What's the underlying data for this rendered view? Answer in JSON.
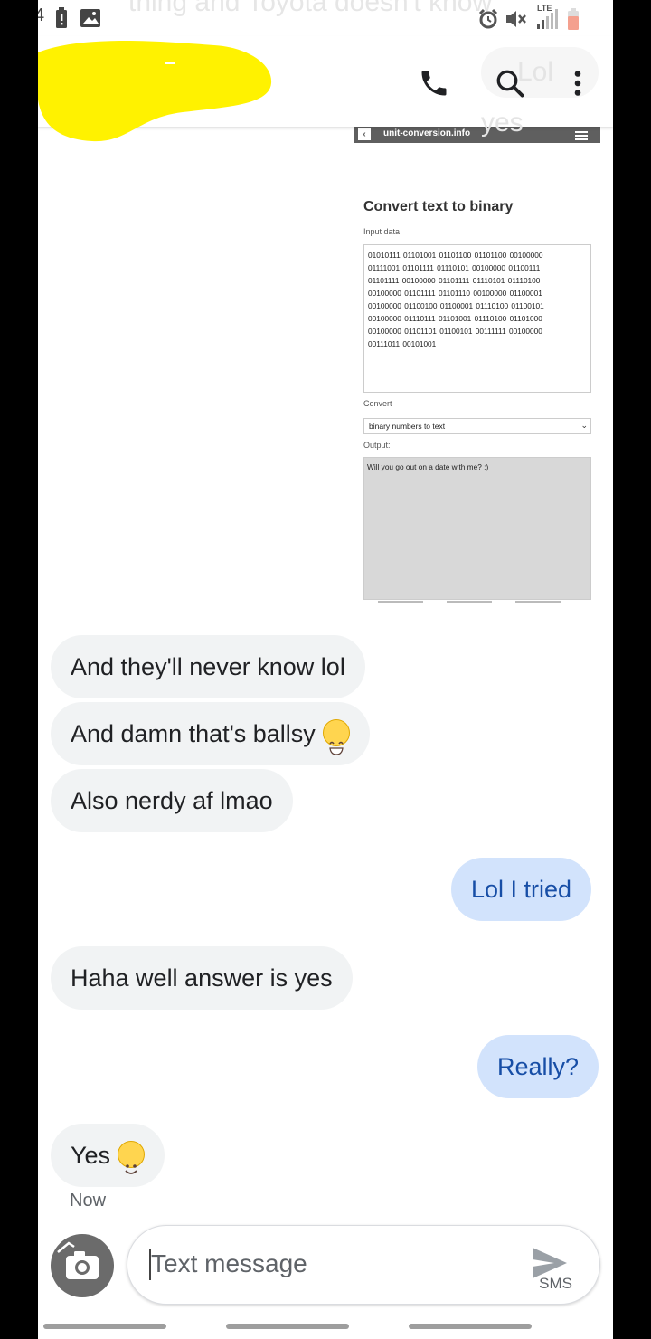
{
  "status_bar": {
    "time_fragment": "4",
    "ghost_text": "thing and Toyota doesn't know",
    "network_label": "LTE",
    "icons": [
      "battery-alert-icon",
      "image-icon",
      "alarm-icon",
      "mute-icon",
      "signal-icon",
      "battery-icon"
    ]
  },
  "app_bar": {
    "contact_name_redacted": true,
    "ghost_pill_text": "Lol yes",
    "icons": [
      "phone-icon",
      "search-icon",
      "more-vert-icon"
    ]
  },
  "shared_image": {
    "site": "unit-conversion.info",
    "title": "Convert text to binary",
    "input_label": "Input data",
    "input_lines": [
      "01010111 01101001 01101100 01101100 00100000",
      "01111001 01101111 01110101 00100000 01100111",
      "01101111 00100000 01101111 01110101 01110100",
      "00100000 01101111 01101110 00100000 01100001",
      "00100000 01100100 01100001 01110100 01100101",
      "00100000 01110111 01101001 01110100 01101000",
      "00100000 01101101 01100101 00111111 00100000",
      "00111011 00101001"
    ],
    "convert_label": "Convert",
    "convert_value": "binary numbers to text",
    "output_label": "Output:",
    "output_value": "Will you go out on a date with me? ;)"
  },
  "messages": [
    {
      "direction": "in",
      "text": "And they'll never know lol"
    },
    {
      "direction": "in",
      "text": "And damn that's ballsy",
      "emoji": "laughing-face"
    },
    {
      "direction": "in",
      "text": "Also nerdy af lmao"
    },
    {
      "direction": "out",
      "text": "Lol I tried"
    },
    {
      "direction": "in",
      "text": "Haha well answer is yes"
    },
    {
      "direction": "out",
      "text": "Really?"
    },
    {
      "direction": "in",
      "text": "Yes",
      "emoji": "smiling-face"
    }
  ],
  "timestamp": "Now",
  "composer": {
    "placeholder": "Text message",
    "send_label": "SMS"
  },
  "colors": {
    "incoming_bubble": "#f1f3f4",
    "outgoing_bubble": "#d2e3fc",
    "outgoing_text": "#174ea6",
    "redaction": "#fff200"
  }
}
